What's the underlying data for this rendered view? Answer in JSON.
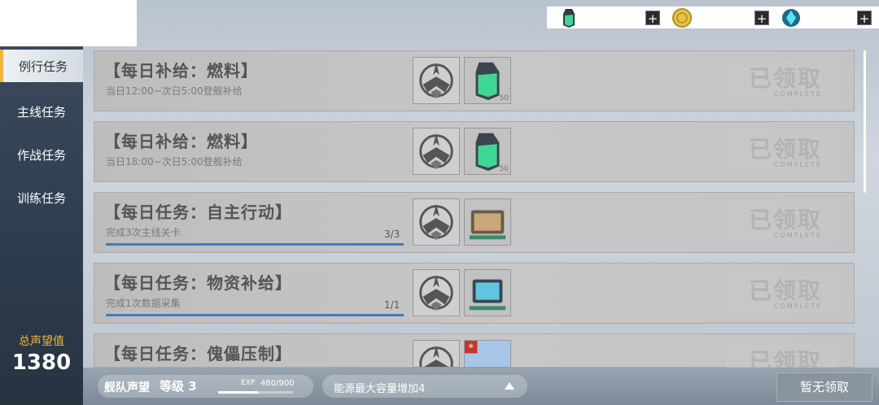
{
  "resources": {
    "fuel_icon": "fuel-icon",
    "coin_icon": "coin-icon",
    "gem_icon": "gem-icon",
    "plus": "+"
  },
  "sidebar": {
    "items": [
      {
        "label": "例行任务",
        "active": true
      },
      {
        "label": "主线任务",
        "active": false
      },
      {
        "label": "作战任务",
        "active": false
      },
      {
        "label": "训练任务",
        "active": false
      }
    ],
    "prestige_label": "总声望值",
    "prestige_value": "1380"
  },
  "tasks": [
    {
      "title": "【每日补给：燃料】",
      "desc": "当日12:00~次日5:00登舰补给",
      "reward_qty": "50",
      "stamp": "已领取",
      "stamp_sub": "COMPLETE"
    },
    {
      "title": "【每日补给：燃料】",
      "desc": "当日18:00~次日5:00登舰补给",
      "reward_qty": "50",
      "stamp": "已领取",
      "stamp_sub": "COMPLETE"
    },
    {
      "title": "【每日任务：自主行动】",
      "desc": "完成3次主线关卡",
      "progress": "3/3",
      "stamp": "已领取",
      "stamp_sub": "COMPLETE"
    },
    {
      "title": "【每日任务：物资补给】",
      "desc": "完成1次数据采集",
      "progress": "1/1",
      "stamp": "已领取",
      "stamp_sub": "COMPLETE"
    },
    {
      "title": "【每日任务：傀儡压制】",
      "stamp": "已领取"
    }
  ],
  "bottom": {
    "fleet_name": "舰队声望",
    "fleet_level": "等级 3",
    "exp_label": "EXP",
    "exp_value": "480/900",
    "exp_fraction": 0.533,
    "info": "能源最大容量增加4",
    "claim_button": "暂无领取"
  },
  "colors": {
    "accent": "#f2b53c",
    "progress": "#3e7ec2",
    "sidebar": "#2d3c4d"
  }
}
